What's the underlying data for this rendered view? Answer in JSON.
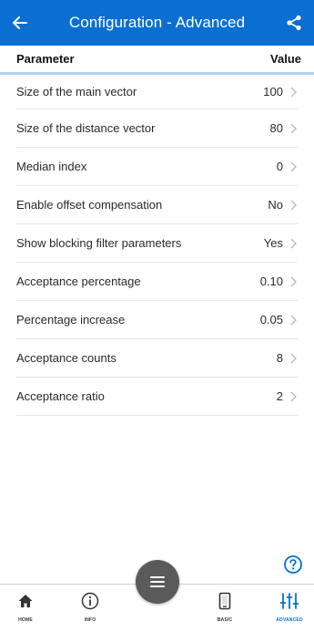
{
  "header": {
    "title": "Configuration - Advanced",
    "back_icon": "arrow-left-icon",
    "share_icon": "share-icon"
  },
  "columns": {
    "parameter": "Parameter",
    "value": "Value"
  },
  "parameters": [
    {
      "label": "Size of the main vector",
      "value": "100"
    },
    {
      "label": "Size of the distance vector",
      "value": "80"
    },
    {
      "label": "Median index",
      "value": "0"
    },
    {
      "label": "Enable offset compensation",
      "value": "No"
    },
    {
      "label": "Show blocking filter parameters",
      "value": "Yes"
    },
    {
      "label": "Acceptance percentage",
      "value": "0.10"
    },
    {
      "label": "Percentage increase",
      "value": "0.05"
    },
    {
      "label": "Acceptance counts",
      "value": "8"
    },
    {
      "label": "Acceptance ratio",
      "value": "2"
    }
  ],
  "bottom_nav": {
    "home": "HOME",
    "info": "INFO",
    "basic": "BASIC",
    "advanced": "ADVANCED",
    "menu_icon": "menu-icon"
  },
  "colors": {
    "primary": "#0a6fd1",
    "fab": "#5a5a5a",
    "divider": "#b5d3ef"
  }
}
